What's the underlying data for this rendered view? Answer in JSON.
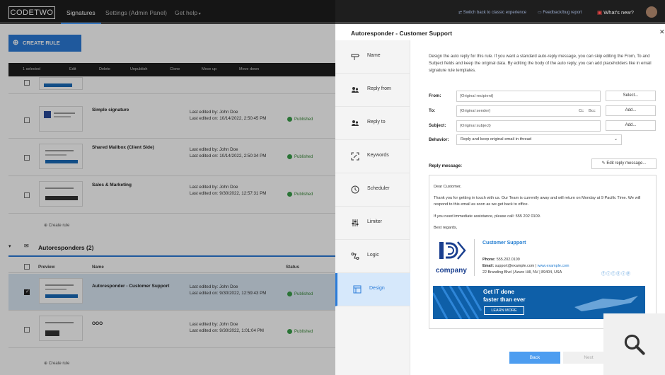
{
  "topbar": {
    "logo": "CODETWO",
    "nav": [
      "Signatures",
      "Settings (Admin Panel)",
      "Get help"
    ],
    "switch_link": "Switch back to classic experience",
    "feedback": "Feedback/bug report",
    "whats_new": "What's new?"
  },
  "main": {
    "create_rule": "CREATE RULE",
    "toolbar": {
      "selected": "1 selected",
      "edit": "Edit",
      "delete": "Delete",
      "unpublish": "Unpublish",
      "clone": "Clone",
      "move_up": "Move up",
      "move_down": "Move down"
    },
    "rows": [
      {
        "name": "Simple signature",
        "edited_by": "Last edited by: John Doe",
        "edited_on": "Last edited on: 10/14/2022, 2:50:45 PM",
        "status": "Published"
      },
      {
        "name": "Shared Mailbox (Client Side)",
        "edited_by": "Last edited by: John Doe",
        "edited_on": "Last edited on: 10/14/2022, 2:50:34 PM",
        "status": "Published"
      },
      {
        "name": "Sales & Marketing",
        "edited_by": "Last edited by: John Doe",
        "edited_on": "Last edited on: 9/30/2022, 12:57:31 PM",
        "status": "Published"
      }
    ],
    "create_rule_link": "Create rule",
    "group": {
      "title": "Autoresponders (2)",
      "col_preview": "Preview",
      "col_name": "Name",
      "col_status": "Status"
    },
    "group_rows": [
      {
        "name": "Autoresponder - Customer Support",
        "edited_by": "Last edited by: John Doe",
        "edited_on": "Last edited on: 9/30/2022, 12:59:43 PM",
        "status": "Published"
      },
      {
        "name": "OOO",
        "edited_by": "Last edited by: John Doe",
        "edited_on": "Last edited on: 9/30/2022, 1:01:04 PM",
        "status": "Published"
      }
    ],
    "create_rule_link2": "Create rule"
  },
  "panel": {
    "title": "Autoresponder - Customer Support",
    "nav": [
      {
        "label": "Name",
        "icon": "signpost-icon"
      },
      {
        "label": "Reply from",
        "icon": "users-icon"
      },
      {
        "label": "Reply to",
        "icon": "users-icon"
      },
      {
        "label": "Keywords",
        "icon": "keywords-icon"
      },
      {
        "label": "Scheduler",
        "icon": "clock-icon"
      },
      {
        "label": "Limiter",
        "icon": "sliders-icon"
      },
      {
        "label": "Logic",
        "icon": "logic-icon"
      },
      {
        "label": "Design",
        "icon": "design-icon"
      }
    ],
    "description": "Design the auto reply for this rule. If you want a standard auto-reply message, you can skip editing the From, To and Subject fields and keep the original data. By editing the body of the auto reply, you can add placeholders like in email signature rule templates.",
    "from_label": "From:",
    "from_value": "{Original recipient}",
    "select_btn": "Select...",
    "to_label": "To:",
    "to_value": "{Original sender}",
    "cc": "Cc",
    "bcc": "Bcc",
    "add_btn": "Add...",
    "subject_label": "Subject:",
    "subject_value": "{Original subject}",
    "add_btn2": "Add...",
    "behavior_label": "Behavior:",
    "behavior_value": "Reply and keep original email in thread",
    "reply_label": "Reply message:",
    "edit_reply": "Edit reply message...",
    "message": {
      "greeting": "Dear Customer,",
      "body": "Thank you for getting in touch with us. Our Team is currently away and will return on Monday at 9 Pacific Time. We will respond to this email as soon as we get back to office.",
      "urgent": "If you need immediate assistance, please call: 555 202 0109.",
      "closing": "Best regards,"
    },
    "signature": {
      "name": "Customer Support",
      "company": "company",
      "phone_label": "Phone:",
      "phone": "555.202.0109",
      "email_label": "Email:",
      "email": "support@example.com",
      "separator": "|",
      "website": "www.example.com",
      "address": "22 Branding Blvd | Azure Hill, NV | 89404, USA"
    },
    "banner": {
      "line1": "Get IT done",
      "line2": "faster than ever",
      "button": "LEARN MORE"
    },
    "back": "Back",
    "next": "Next"
  },
  "colors": {
    "accent": "#2b7bd8",
    "active_nav": "#d6e8fb",
    "published": "#3aa04a"
  }
}
